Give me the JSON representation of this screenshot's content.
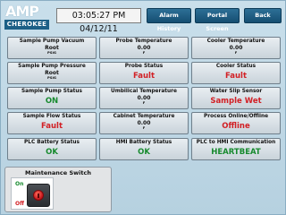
{
  "header": {
    "logo_top": "AMP",
    "logo_bottom": "CHEROKEE",
    "datetime": "03:05:27 PM 04/12/11",
    "buttons": {
      "alarm_history": "Alarm History",
      "portal_screen": "Portal Screen",
      "back": "Back"
    }
  },
  "tiles": [
    {
      "label": "Sample Pump Vacuum",
      "value": "Root",
      "unit": "PSIG"
    },
    {
      "label": "Probe Temperature",
      "value": "0.00",
      "unit": "F"
    },
    {
      "label": "Cooler Temperature",
      "value": "0.00",
      "unit": "F"
    },
    {
      "label": "Sample Pump Pressure",
      "value": "Root",
      "unit": "PSIG"
    },
    {
      "label": "Probe Status",
      "status": "Fault",
      "color": "#d21f24"
    },
    {
      "label": "Cooler Status",
      "status": "Fault",
      "color": "#d21f24"
    },
    {
      "label": "Sample Pump Status",
      "status": "ON",
      "color": "#178a2e"
    },
    {
      "label": "Umbilical Temperature",
      "value": "0.00",
      "unit": "F"
    },
    {
      "label": "Water Slip Sensor",
      "status": "Sample Wet",
      "color": "#d21f24"
    },
    {
      "label": "Sample Flow Status",
      "status": "Fault",
      "color": "#d21f24"
    },
    {
      "label": "Cabinet Temperature",
      "value": "0.00",
      "unit": "F"
    },
    {
      "label": "Process Online/Offline",
      "status": "Offline",
      "color": "#d21f24"
    },
    {
      "label": "PLC Battery Status",
      "status": "OK",
      "color": "#178a2e"
    },
    {
      "label": "HMI Battery Status",
      "status": "OK",
      "color": "#178a2e"
    },
    {
      "label": "PLC to HMI Communication",
      "status": "HEARTBEAT",
      "color": "#178a2e"
    }
  ],
  "maintenance": {
    "title": "Maintenance Switch",
    "on_label": "On",
    "off_label": "Off",
    "icon": "rotary-switch-icon"
  },
  "colors": {
    "fault": "#d21f24",
    "ok": "#178a2e",
    "nav_button": "#1f5e84",
    "background": "#c3dae7"
  }
}
